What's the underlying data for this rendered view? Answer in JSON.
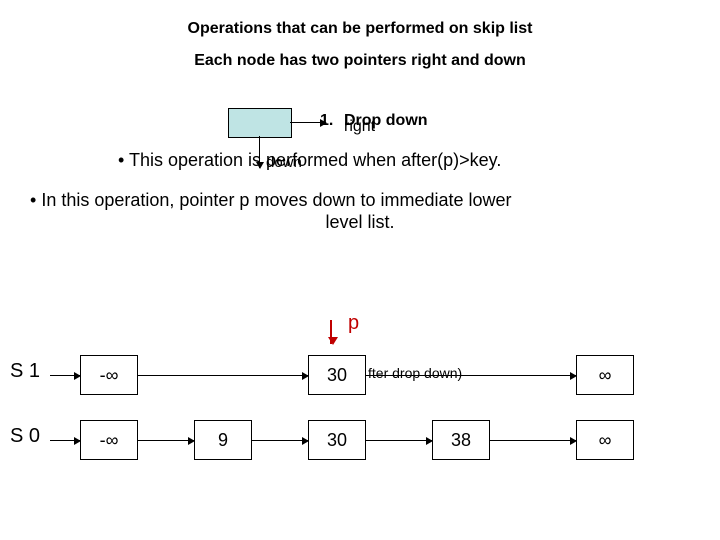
{
  "title1": "Operations that can be performed on skip list",
  "title2": "Each node has two pointers right and down",
  "heading_number": "1.",
  "heading_text": "Drop down",
  "ptr_right_label": "right",
  "ptr_down_label": "down",
  "bullet1": "This operation is performed when after(p)>key.",
  "bullet2_a": "In this operation, pointer p moves down to immediate lower",
  "bullet2_b": "level list.",
  "p_label": "p",
  "after_note": "fter drop down)",
  "levels": {
    "s1": "S 1",
    "s0": "S 0"
  },
  "nodes": {
    "neg_inf": "-∞",
    "pos_inf": "∞",
    "n9": "9",
    "n30": "30",
    "n38": "38"
  }
}
